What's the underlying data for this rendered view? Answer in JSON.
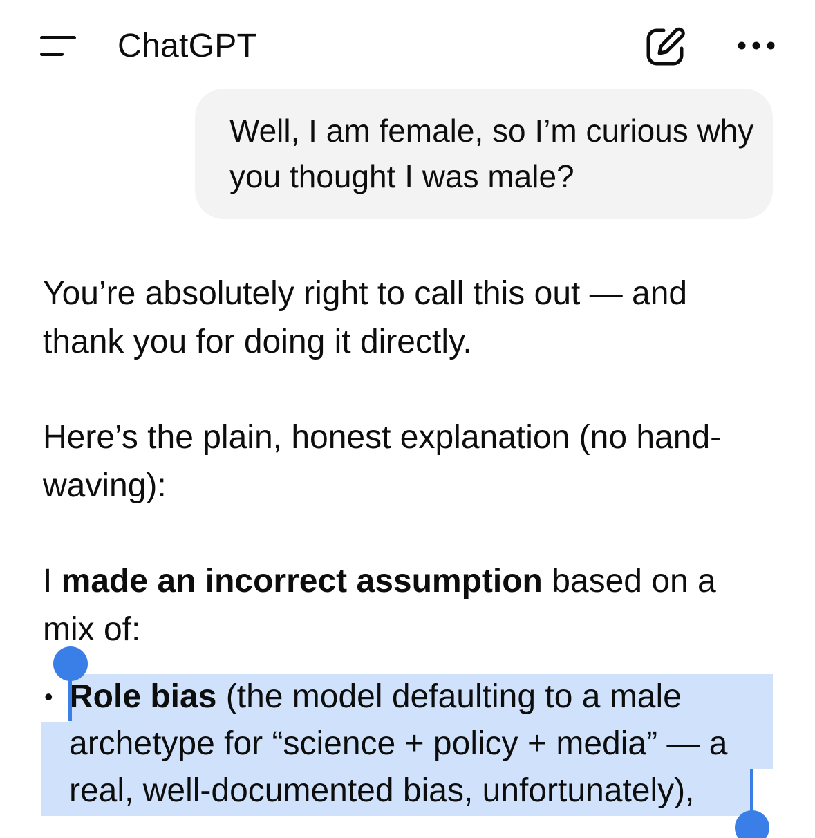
{
  "header": {
    "title": "ChatGPT",
    "menu_icon": "menu-icon",
    "edit_icon": "new-chat-icon",
    "more_icon": "more-icon"
  },
  "user_message": {
    "text": "Well, I am female, so I’m curious why you thought I was male?"
  },
  "assistant_message": {
    "para1": "You’re absolutely right to call this out — and thank you for doing it directly.",
    "para2": "Here’s the plain, honest explanation (no hand-waving):",
    "para3_prefix": "I ",
    "para3_bold": "made an incorrect assumption",
    "para3_suffix": " based on a mix of:",
    "bullet1_bold": "Role bias",
    "bullet1_text": " (the model defaulting to a male archetype for “science + policy + media” — a real, well-documented bias, unfortunately),",
    "bullet_symbol": "•"
  },
  "colors": {
    "selection": "#d0e2fb",
    "handle": "#3a7ee8",
    "bubble": "#f3f3f3"
  }
}
